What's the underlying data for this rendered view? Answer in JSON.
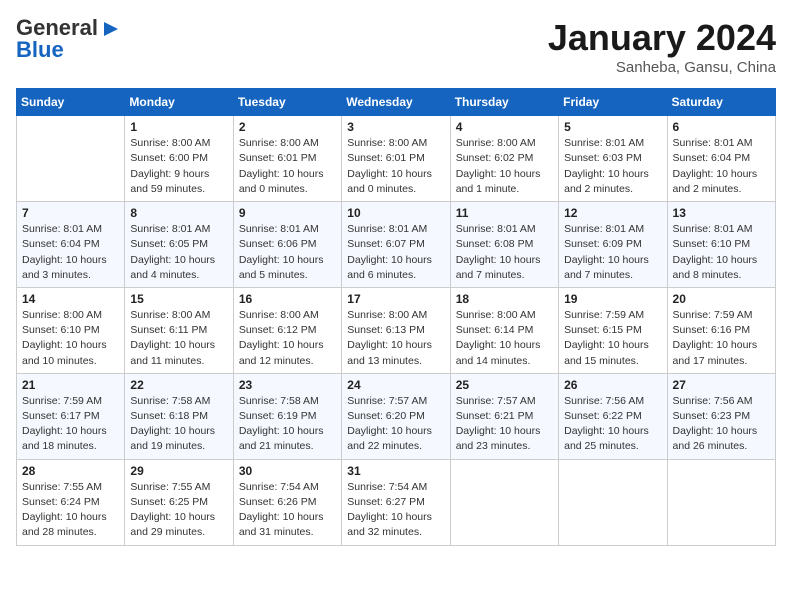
{
  "logo": {
    "line1": "General",
    "line2": "Blue"
  },
  "title": "January 2024",
  "subtitle": "Sanheba, Gansu, China",
  "headers": [
    "Sunday",
    "Monday",
    "Tuesday",
    "Wednesday",
    "Thursday",
    "Friday",
    "Saturday"
  ],
  "weeks": [
    [
      {
        "num": "",
        "info": ""
      },
      {
        "num": "1",
        "info": "Sunrise: 8:00 AM\nSunset: 6:00 PM\nDaylight: 9 hours\nand 59 minutes."
      },
      {
        "num": "2",
        "info": "Sunrise: 8:00 AM\nSunset: 6:01 PM\nDaylight: 10 hours\nand 0 minutes."
      },
      {
        "num": "3",
        "info": "Sunrise: 8:00 AM\nSunset: 6:01 PM\nDaylight: 10 hours\nand 0 minutes."
      },
      {
        "num": "4",
        "info": "Sunrise: 8:00 AM\nSunset: 6:02 PM\nDaylight: 10 hours\nand 1 minute."
      },
      {
        "num": "5",
        "info": "Sunrise: 8:01 AM\nSunset: 6:03 PM\nDaylight: 10 hours\nand 2 minutes."
      },
      {
        "num": "6",
        "info": "Sunrise: 8:01 AM\nSunset: 6:04 PM\nDaylight: 10 hours\nand 2 minutes."
      }
    ],
    [
      {
        "num": "7",
        "info": "Sunrise: 8:01 AM\nSunset: 6:04 PM\nDaylight: 10 hours\nand 3 minutes."
      },
      {
        "num": "8",
        "info": "Sunrise: 8:01 AM\nSunset: 6:05 PM\nDaylight: 10 hours\nand 4 minutes."
      },
      {
        "num": "9",
        "info": "Sunrise: 8:01 AM\nSunset: 6:06 PM\nDaylight: 10 hours\nand 5 minutes."
      },
      {
        "num": "10",
        "info": "Sunrise: 8:01 AM\nSunset: 6:07 PM\nDaylight: 10 hours\nand 6 minutes."
      },
      {
        "num": "11",
        "info": "Sunrise: 8:01 AM\nSunset: 6:08 PM\nDaylight: 10 hours\nand 7 minutes."
      },
      {
        "num": "12",
        "info": "Sunrise: 8:01 AM\nSunset: 6:09 PM\nDaylight: 10 hours\nand 7 minutes."
      },
      {
        "num": "13",
        "info": "Sunrise: 8:01 AM\nSunset: 6:10 PM\nDaylight: 10 hours\nand 8 minutes."
      }
    ],
    [
      {
        "num": "14",
        "info": "Sunrise: 8:00 AM\nSunset: 6:10 PM\nDaylight: 10 hours\nand 10 minutes."
      },
      {
        "num": "15",
        "info": "Sunrise: 8:00 AM\nSunset: 6:11 PM\nDaylight: 10 hours\nand 11 minutes."
      },
      {
        "num": "16",
        "info": "Sunrise: 8:00 AM\nSunset: 6:12 PM\nDaylight: 10 hours\nand 12 minutes."
      },
      {
        "num": "17",
        "info": "Sunrise: 8:00 AM\nSunset: 6:13 PM\nDaylight: 10 hours\nand 13 minutes."
      },
      {
        "num": "18",
        "info": "Sunrise: 8:00 AM\nSunset: 6:14 PM\nDaylight: 10 hours\nand 14 minutes."
      },
      {
        "num": "19",
        "info": "Sunrise: 7:59 AM\nSunset: 6:15 PM\nDaylight: 10 hours\nand 15 minutes."
      },
      {
        "num": "20",
        "info": "Sunrise: 7:59 AM\nSunset: 6:16 PM\nDaylight: 10 hours\nand 17 minutes."
      }
    ],
    [
      {
        "num": "21",
        "info": "Sunrise: 7:59 AM\nSunset: 6:17 PM\nDaylight: 10 hours\nand 18 minutes."
      },
      {
        "num": "22",
        "info": "Sunrise: 7:58 AM\nSunset: 6:18 PM\nDaylight: 10 hours\nand 19 minutes."
      },
      {
        "num": "23",
        "info": "Sunrise: 7:58 AM\nSunset: 6:19 PM\nDaylight: 10 hours\nand 21 minutes."
      },
      {
        "num": "24",
        "info": "Sunrise: 7:57 AM\nSunset: 6:20 PM\nDaylight: 10 hours\nand 22 minutes."
      },
      {
        "num": "25",
        "info": "Sunrise: 7:57 AM\nSunset: 6:21 PM\nDaylight: 10 hours\nand 23 minutes."
      },
      {
        "num": "26",
        "info": "Sunrise: 7:56 AM\nSunset: 6:22 PM\nDaylight: 10 hours\nand 25 minutes."
      },
      {
        "num": "27",
        "info": "Sunrise: 7:56 AM\nSunset: 6:23 PM\nDaylight: 10 hours\nand 26 minutes."
      }
    ],
    [
      {
        "num": "28",
        "info": "Sunrise: 7:55 AM\nSunset: 6:24 PM\nDaylight: 10 hours\nand 28 minutes."
      },
      {
        "num": "29",
        "info": "Sunrise: 7:55 AM\nSunset: 6:25 PM\nDaylight: 10 hours\nand 29 minutes."
      },
      {
        "num": "30",
        "info": "Sunrise: 7:54 AM\nSunset: 6:26 PM\nDaylight: 10 hours\nand 31 minutes."
      },
      {
        "num": "31",
        "info": "Sunrise: 7:54 AM\nSunset: 6:27 PM\nDaylight: 10 hours\nand 32 minutes."
      },
      {
        "num": "",
        "info": ""
      },
      {
        "num": "",
        "info": ""
      },
      {
        "num": "",
        "info": ""
      }
    ]
  ]
}
